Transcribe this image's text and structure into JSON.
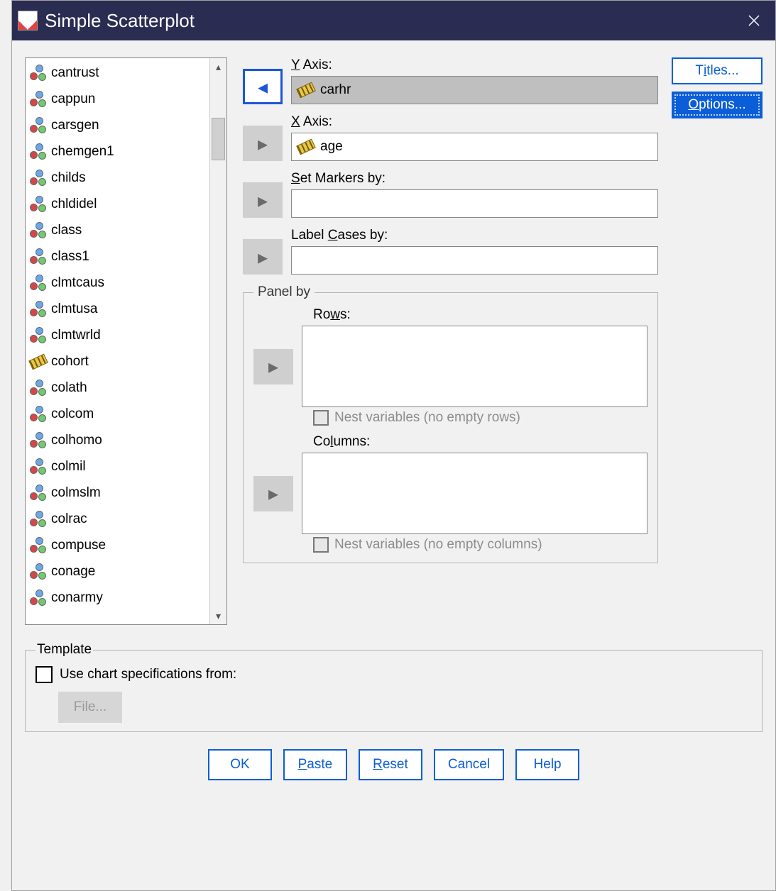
{
  "window": {
    "title": "Simple Scatterplot"
  },
  "variables": [
    {
      "name": "cantrust",
      "type": "nominal"
    },
    {
      "name": "cappun",
      "type": "nominal"
    },
    {
      "name": "carsgen",
      "type": "nominal"
    },
    {
      "name": "chemgen1",
      "type": "nominal"
    },
    {
      "name": "childs",
      "type": "nominal"
    },
    {
      "name": "chldidel",
      "type": "nominal"
    },
    {
      "name": "class",
      "type": "nominal"
    },
    {
      "name": "class1",
      "type": "nominal"
    },
    {
      "name": "clmtcaus",
      "type": "nominal"
    },
    {
      "name": "clmtusa",
      "type": "nominal"
    },
    {
      "name": "clmtwrld",
      "type": "nominal"
    },
    {
      "name": "cohort",
      "type": "scale"
    },
    {
      "name": "colath",
      "type": "nominal"
    },
    {
      "name": "colcom",
      "type": "nominal"
    },
    {
      "name": "colhomo",
      "type": "nominal"
    },
    {
      "name": "colmil",
      "type": "nominal"
    },
    {
      "name": "colmslm",
      "type": "nominal"
    },
    {
      "name": "colrac",
      "type": "nominal"
    },
    {
      "name": "compuse",
      "type": "nominal"
    },
    {
      "name": "conage",
      "type": "nominal"
    },
    {
      "name": "conarmy",
      "type": "nominal"
    }
  ],
  "fields": {
    "y_axis": {
      "label_pre": "Y",
      "label_post": " Axis:",
      "value": "carhr",
      "has_icon": true,
      "shaded": true
    },
    "x_axis": {
      "label_pre": "X",
      "label_post": " Axis:",
      "value": "age",
      "has_icon": true,
      "shaded": false
    },
    "set_markers": {
      "label_pre": "S",
      "label_post": "et Markers by:",
      "value": "",
      "has_icon": false,
      "shaded": false
    },
    "label_cases": {
      "label_plain": "Label ",
      "label_pre": "C",
      "label_post": "ases by:",
      "value": "",
      "has_icon": false,
      "shaded": false
    }
  },
  "panel": {
    "legend": "Panel by",
    "rows_label_pre": "Ro",
    "rows_label_ul": "w",
    "rows_label_post": "s:",
    "nest_rows_pre": "N",
    "nest_rows_post": "est variables (no empty rows)",
    "cols_label_pre": "Co",
    "cols_label_ul": "l",
    "cols_label_post": "umns:",
    "nest_cols_pre": "N",
    "nest_cols_ul": "e",
    "nest_cols_post": "st variables (no empty columns)"
  },
  "side_buttons": {
    "titles_pre": "T",
    "titles_ul": "i",
    "titles_post": "tles...",
    "options_pre": "",
    "options_ul": "O",
    "options_post": "ptions..."
  },
  "template": {
    "legend": "Template",
    "use_pre": "",
    "use_ul": "U",
    "use_post": "se chart specifications from:",
    "file_pre": "",
    "file_ul": "F",
    "file_post": "ile..."
  },
  "buttons": {
    "ok": "OK",
    "paste_ul": "P",
    "paste_post": "aste",
    "reset_ul": "R",
    "reset_post": "eset",
    "cancel": "Cancel",
    "help": "Help"
  }
}
